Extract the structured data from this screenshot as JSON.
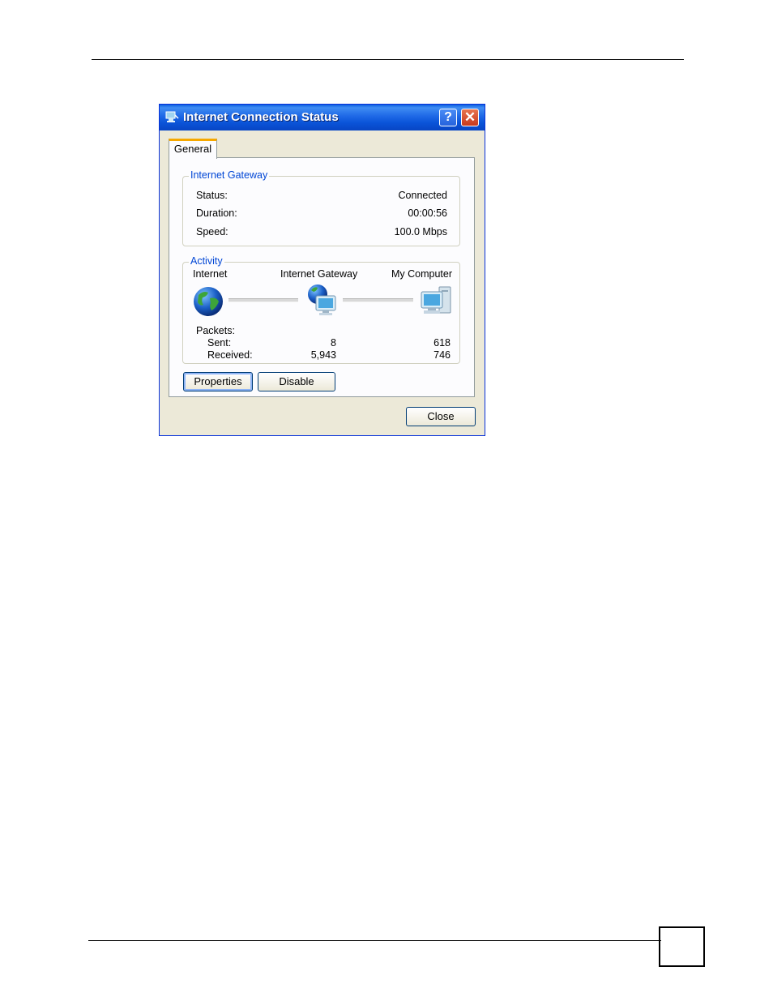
{
  "window": {
    "title": "Internet Connection Status",
    "help_glyph": "?",
    "close_glyph": "✕"
  },
  "tabs": [
    {
      "label": "General"
    }
  ],
  "gateway_group": {
    "legend": "Internet Gateway",
    "rows": [
      {
        "label": "Status:",
        "value": "Connected"
      },
      {
        "label": "Duration:",
        "value": "00:00:56"
      },
      {
        "label": "Speed:",
        "value": "100.0 Mbps"
      }
    ]
  },
  "activity_group": {
    "legend": "Activity",
    "nodes": {
      "internet": "Internet",
      "gateway": "Internet Gateway",
      "computer": "My Computer"
    },
    "packets_label": "Packets:",
    "sent_label": "Sent:",
    "received_label": "Received:",
    "gateway_sent": "8",
    "gateway_received": "5,943",
    "computer_sent": "618",
    "computer_received": "746"
  },
  "buttons": {
    "properties": "Properties",
    "disable": "Disable",
    "close": "Close"
  },
  "icons": [
    "network-connection-icon",
    "help-icon",
    "close-icon",
    "globe-icon",
    "gateway-icon",
    "computer-icon"
  ]
}
